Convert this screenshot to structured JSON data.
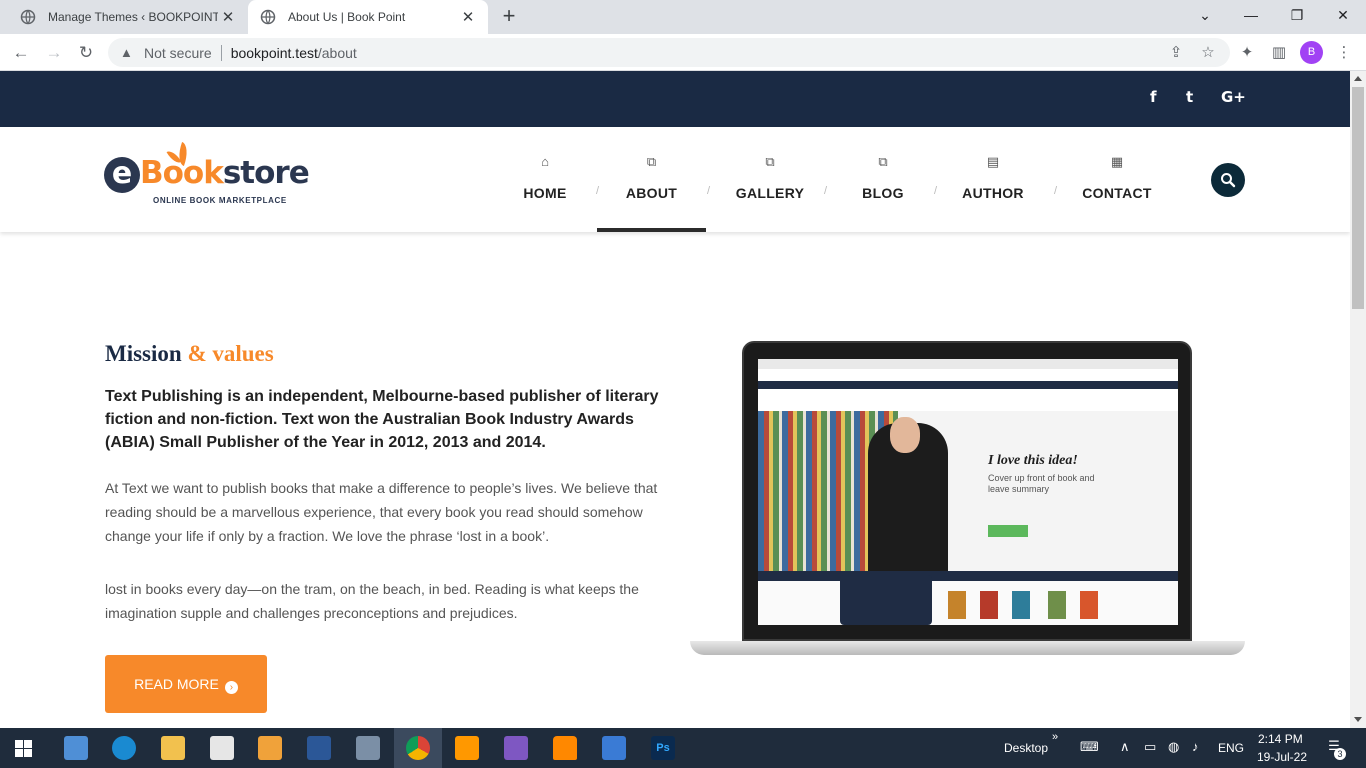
{
  "browser": {
    "tabs": [
      {
        "title": "Manage Themes ‹ BOOKPOINT —",
        "close": "✕"
      },
      {
        "title": "About Us | Book Point",
        "close": "✕"
      }
    ],
    "new_tab": "+",
    "address": {
      "security": "Not secure",
      "host": "bookpoint.test",
      "path": "/about"
    },
    "profile_initial": "B"
  },
  "site": {
    "social": [
      "f",
      "t",
      "G+"
    ],
    "logo": {
      "e": "e",
      "word_orange": "Book",
      "word_navy": "store",
      "tagline": "ONLINE BOOK MARKETPLACE"
    },
    "nav": [
      {
        "label": "HOME",
        "icon": "home-icon",
        "active": false
      },
      {
        "label": "ABOUT",
        "icon": "copy-icon",
        "active": true
      },
      {
        "label": "GALLERY",
        "icon": "copy-icon",
        "active": false
      },
      {
        "label": "BLOG",
        "icon": "copy-icon",
        "active": false
      },
      {
        "label": "AUTHOR",
        "icon": "file-icon",
        "active": false
      },
      {
        "label": "CONTACT",
        "icon": "building-icon",
        "active": false
      }
    ],
    "nav_separator": "/",
    "accent": "#f7892a",
    "navy": "#1a2a44"
  },
  "content": {
    "heading_main": "Mission",
    "heading_accent": "& values",
    "lead": "Text Publishing is an independent, Melbourne-based publisher of literary fiction and non-fiction. Text won the Australian Book Industry Awards (ABIA) Small Publisher of the Year in 2012, 2013 and 2014.",
    "body1": "At Text we want to publish books that make a difference to people’s lives. We believe that reading should be a marvellous experience, that every book you read should somehow change your life if only by a fraction. We love the phrase ‘lost in a book’.",
    "body2": "lost in books every day—on the tram, on the beach, in bed. Reading is what keeps the imagination supple and challenges preconceptions and prejudices.",
    "read_more": "READ MORE",
    "laptop_screen": {
      "headline": "I love this idea!",
      "sub": "Cover up front of book and leave summary"
    }
  },
  "taskbar": {
    "desktop_label": "Desktop",
    "lang": "ENG",
    "time": "2:14 PM",
    "date": "19-Jul-22",
    "notifications": "3"
  }
}
